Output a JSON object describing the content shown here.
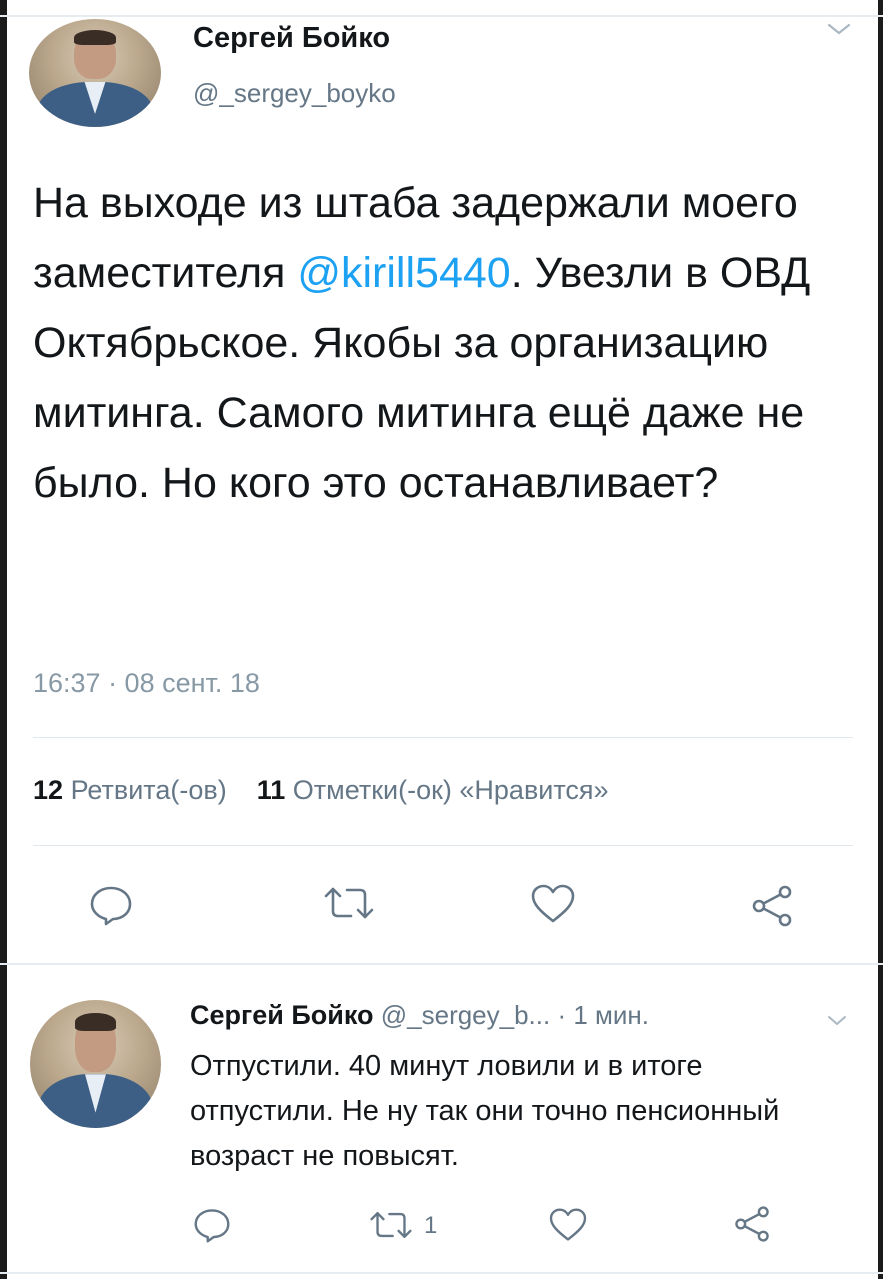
{
  "tweet": {
    "author_name": "Сергей Бойко",
    "author_handle": "@_sergey_boyko",
    "text_before_mention": "На выходе из штаба задержали моего заместителя ",
    "mention": "@kirill5440",
    "text_after_mention": ". Увезли в ОВД Октябрьское. Якобы за организацию митинга. Самого митинга ещё даже не было. Но кого это останавливает?",
    "timestamp": "16:37 · 08 сент. 18",
    "retweets_count": "12",
    "retweets_label": "Ретвита(-ов)",
    "likes_count": "11",
    "likes_label": "Отметки(-ок) «Нравится»"
  },
  "reply": {
    "author_name": "Сергей Бойко",
    "author_handle": "@_sergey_b...",
    "time": "· 1 мин.",
    "text": "Отпустили. 40 минут ловили и в итоге отпустили. Не ну так они точно пенсионный возраст не повысят.",
    "retweet_count": "1"
  },
  "icons": {
    "reply": "reply-icon",
    "retweet": "retweet-icon",
    "like": "heart-icon",
    "share": "share-icon",
    "menu": "chevron-down-icon"
  },
  "colors": {
    "accent": "#1da1f2",
    "secondary_text": "#657786",
    "primary_text": "#14171a"
  }
}
